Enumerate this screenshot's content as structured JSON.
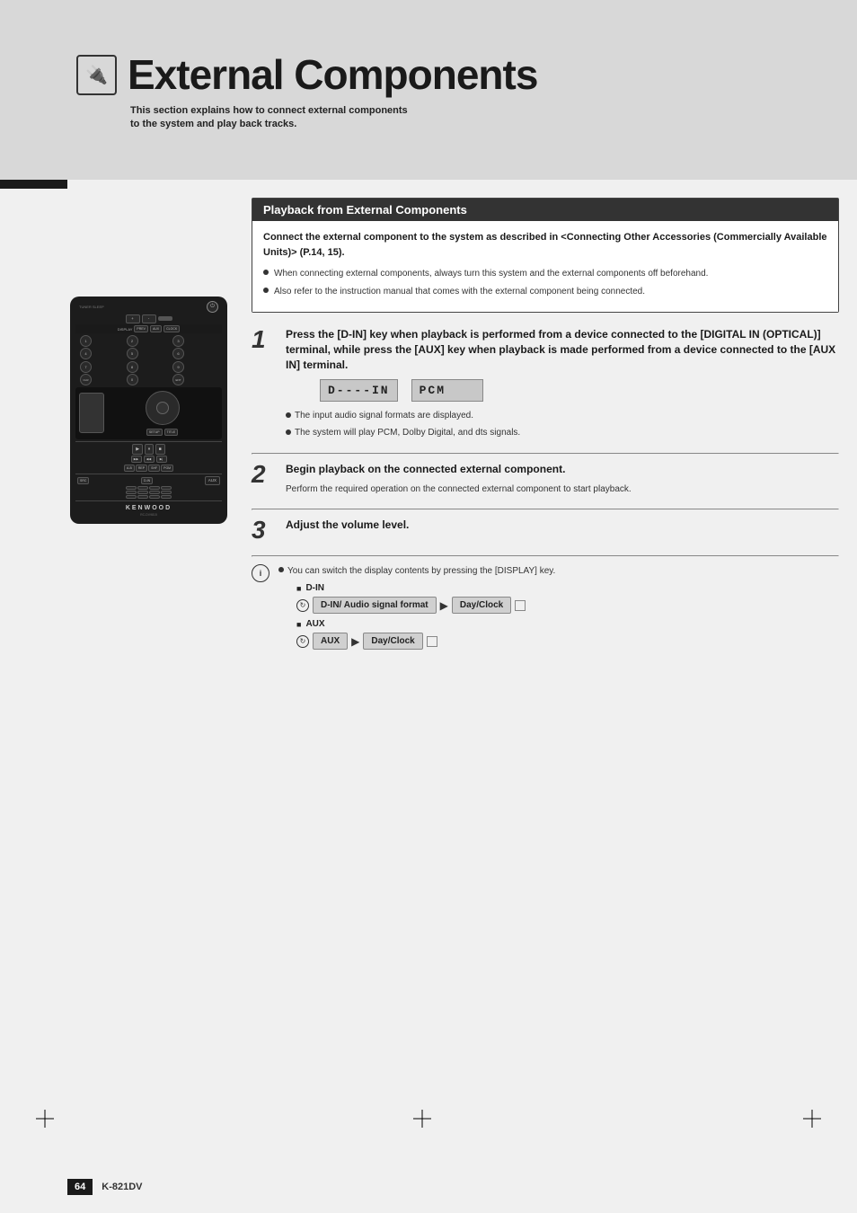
{
  "page": {
    "background_color": "#e8e8e8",
    "page_number": "64",
    "model": "K-821DV"
  },
  "header": {
    "icon_symbol": "🔌",
    "title": "External Components",
    "subtitle_line1": "This section explains how to connect external components",
    "subtitle_line2": "to the system and play back tracks."
  },
  "section": {
    "title": "Playback from External Components",
    "intro": "Connect the external component to the system as described in <Connecting Other Accessories (Commercially Available Units)> (P.14, 15).",
    "bullets": [
      "When connecting external components, always turn this system and the external components off beforehand.",
      "Also refer to the instruction manual that comes with the external component being connected."
    ]
  },
  "steps": [
    {
      "number": "1",
      "title": "Press the [D-IN] key when playback is performed from a device connected to the [DIGITAL IN (OPTICAL)] terminal, while press the [AUX] key when playback is made performed from a device connected to the [AUX IN] terminal.",
      "display_left": "D----IN",
      "display_right": "PCM",
      "notes": [
        "The input audio signal formats are displayed.",
        "The system will play PCM, Dolby Digital, and dts signals."
      ]
    },
    {
      "number": "2",
      "title": "Begin playback on the connected external component.",
      "body": "Perform the required operation on the connected external component to start playback."
    },
    {
      "number": "3",
      "title": "Adjust the volume level."
    }
  ],
  "note_section": {
    "text": "You can switch the display contents by pressing the [DISPLAY] key.",
    "flows": [
      {
        "label": "D-IN",
        "boxes": [
          "D-IN/ Audio signal format",
          "Day/Clock"
        ]
      },
      {
        "label": "AUX",
        "boxes": [
          "AUX",
          "Day/Clock"
        ]
      }
    ]
  },
  "remote": {
    "brand": "KENWOOD",
    "model_line": "RC-DV9815"
  }
}
